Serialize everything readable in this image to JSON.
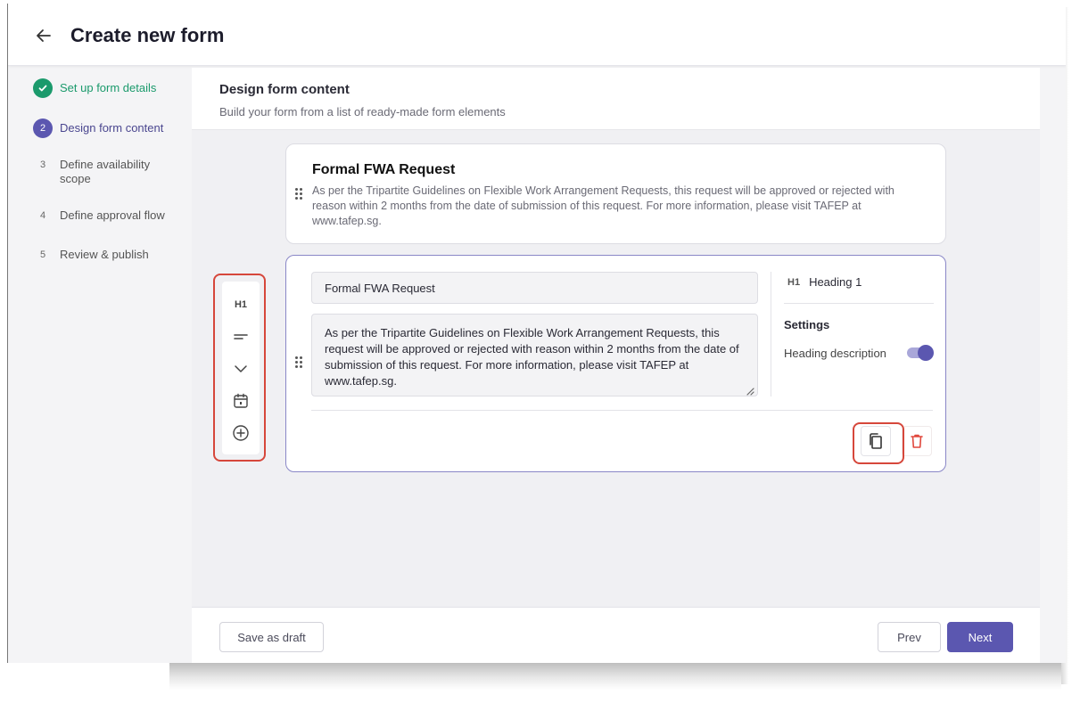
{
  "header": {
    "title": "Create new form"
  },
  "stepper": {
    "steps": [
      {
        "number": "",
        "label": "Set up form details",
        "state": "done"
      },
      {
        "number": "2",
        "label": "Design form content",
        "state": "active"
      },
      {
        "number": "3",
        "label": "Define availability scope",
        "state": "pending"
      },
      {
        "number": "4",
        "label": "Define approval flow",
        "state": "pending"
      },
      {
        "number": "5",
        "label": "Review & publish",
        "state": "pending"
      }
    ]
  },
  "section": {
    "title": "Design form content",
    "subtitle": "Build your form from a list of ready-made form elements"
  },
  "preview_card": {
    "title": "Formal FWA Request",
    "description": "As per the Tripartite Guidelines on Flexible Work Arrangement Requests, this request will be approved or rejected with reason within 2 months from the date of submission of this request. For more information, please visit TAFEP at www.tafep.sg."
  },
  "edit_card": {
    "title_value": "Formal FWA Request",
    "description_value": "As per the Tripartite Guidelines on Flexible Work Arrangement Requests, this request will be approved or rejected with reason within 2 months from the date of submission of this request. For more information, please visit TAFEP at www.tafep.sg.",
    "element_type_tag": "H1",
    "element_type": "Heading 1",
    "settings_title": "Settings",
    "toggle_label": "Heading description",
    "toggle_on": true
  },
  "toolbar": {
    "heading_tag": "H1",
    "tools": [
      "heading-icon",
      "paragraph-icon",
      "dropdown-icon",
      "calendar-icon",
      "add-icon"
    ]
  },
  "footer": {
    "save_draft_label": "Save as draft",
    "prev_label": "Prev",
    "next_label": "Next"
  },
  "colors": {
    "accent": "#5b57b0",
    "success": "#1b9a6c",
    "highlight": "#d6473b",
    "danger": "#e0473c"
  }
}
